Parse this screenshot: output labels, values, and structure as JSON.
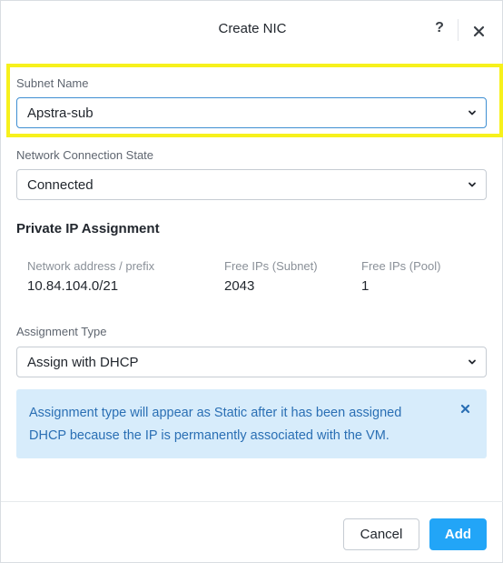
{
  "dialog": {
    "title": "Create NIC",
    "help_label": "?"
  },
  "subnet": {
    "label": "Subnet Name",
    "value": "Apstra-sub"
  },
  "connection_state": {
    "label": "Network Connection State",
    "value": "Connected"
  },
  "private_ip": {
    "title": "Private IP Assignment",
    "stats": [
      {
        "label": "Network address / prefix",
        "value": "10.84.104.0/21"
      },
      {
        "label": "Free IPs (Subnet)",
        "value": "2043"
      },
      {
        "label": "Free IPs (Pool)",
        "value": "1"
      }
    ]
  },
  "assignment_type": {
    "label": "Assignment Type",
    "value": "Assign with DHCP"
  },
  "alert": {
    "text": "Assignment type will appear as Static after it has been assigned DHCP because the IP is permanently associated with the VM."
  },
  "footer": {
    "cancel_label": "Cancel",
    "add_label": "Add"
  },
  "colors": {
    "accent": "#22a5f7",
    "highlight": "#f7f11c",
    "alert_bg": "#d7ecfb",
    "alert_text": "#2a6fb4"
  }
}
